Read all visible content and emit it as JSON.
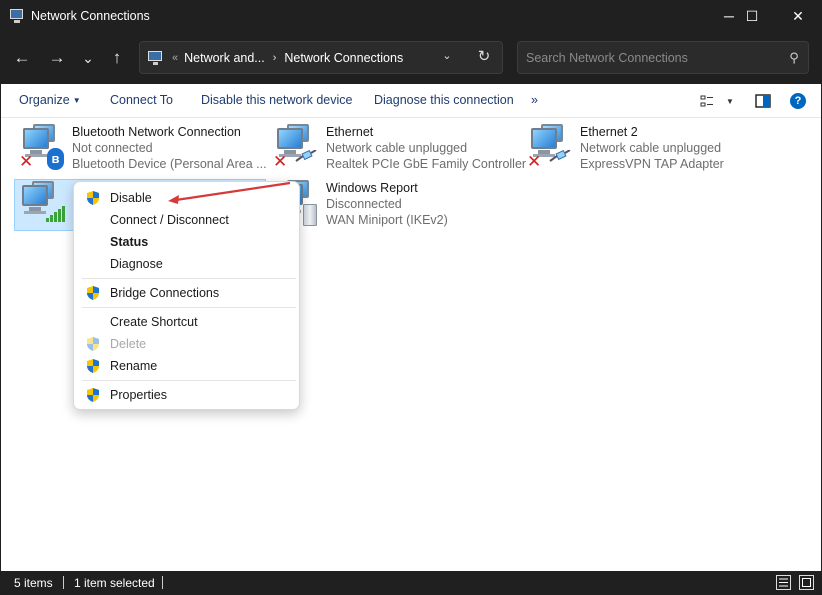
{
  "window": {
    "title": "Network Connections",
    "minimize_glyph": "─",
    "maximize_glyph": "☐",
    "close_glyph": "✕"
  },
  "nav": {
    "back_glyph": "←",
    "forward_glyph": "→",
    "recent_glyph": "⌄",
    "up_glyph": "↑",
    "address_overflow": "«",
    "breadcrumbs": [
      "Network and...",
      "Network Connections"
    ],
    "breadcrumb_separator": "›",
    "dropdown_glyph": "⌄",
    "refresh_glyph": "↻",
    "search_placeholder": "Search Network Connections",
    "search_glyph": "⚲"
  },
  "toolbar": {
    "organize": "Organize",
    "organize_caret": "▼",
    "connect_to": "Connect To",
    "disable_device": "Disable this network device",
    "diagnose": "Diagnose this connection",
    "overflow": "»",
    "view_caret": "▼",
    "help": "?"
  },
  "connections": [
    {
      "name": "Bluetooth Network Connection",
      "status": "Not connected",
      "device": "Bluetooth Device (Personal Area ...",
      "type": "bluetooth",
      "error": true,
      "badge": "ʙ"
    },
    {
      "name": "Ethernet",
      "status": "Network cable unplugged",
      "device": "Realtek PCIe GbE Family Controller",
      "type": "ethernet",
      "error": true
    },
    {
      "name": "Ethernet 2",
      "status": "Network cable unplugged",
      "device": "ExpressVPN TAP Adapter",
      "type": "ethernet",
      "error": true
    },
    {
      "name": "",
      "status": "",
      "device": "",
      "type": "wifi",
      "error": false,
      "selected": true
    },
    {
      "name": "Windows Report",
      "status": "Disconnected",
      "device": "WAN Miniport (IKEv2)",
      "type": "vpn",
      "error": false
    }
  ],
  "error_glyph": "✕",
  "context_menu": {
    "disable": "Disable",
    "connect_disconnect": "Connect / Disconnect",
    "status": "Status",
    "diagnose": "Diagnose",
    "bridge": "Bridge Connections",
    "create_shortcut": "Create Shortcut",
    "delete": "Delete",
    "rename": "Rename",
    "properties": "Properties"
  },
  "status_bar": {
    "item_count": "5 items",
    "selection": "1 item selected"
  },
  "colors": {
    "accent": "#0067c0",
    "toolbar_text": "#1f3b70",
    "selection_bg": "#cce8ff",
    "arrow": "#d43a3a",
    "error_red": "#d32020"
  }
}
